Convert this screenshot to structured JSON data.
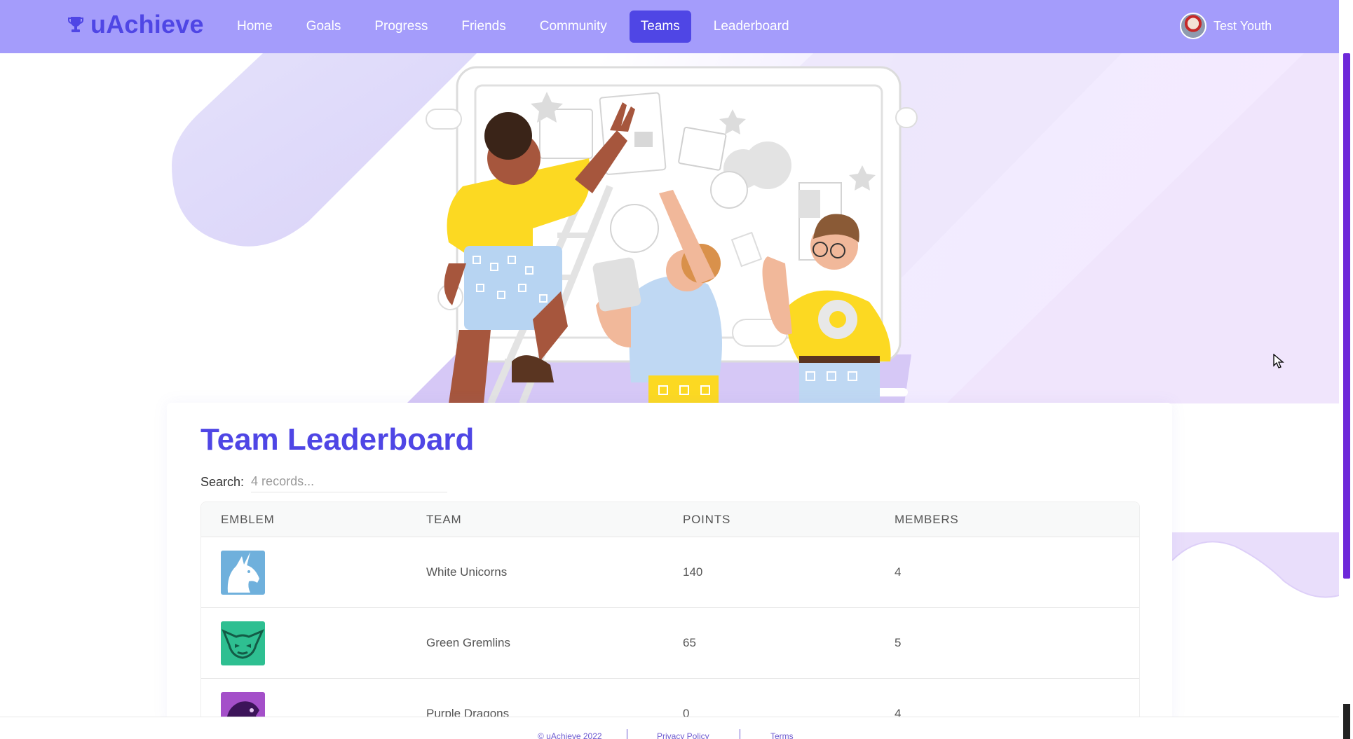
{
  "app": {
    "brand": "uAchieve",
    "user_name": "Test Youth"
  },
  "nav": {
    "items": [
      {
        "label": "Home",
        "active": false
      },
      {
        "label": "Goals",
        "active": false
      },
      {
        "label": "Progress",
        "active": false
      },
      {
        "label": "Friends",
        "active": false
      },
      {
        "label": "Community",
        "active": false
      },
      {
        "label": "Teams",
        "active": true
      },
      {
        "label": "Leaderboard",
        "active": false
      }
    ]
  },
  "leaderboard": {
    "title": "Team Leaderboard",
    "search_label": "Search:",
    "search_placeholder": "4 records...",
    "columns": [
      "EMBLEM",
      "TEAM",
      "POINTS",
      "MEMBERS"
    ],
    "rows": [
      {
        "emblem": "unicorn-emblem",
        "emblem_color": "#6fb0dc",
        "team": "White Unicorns",
        "points": "140",
        "members": "4"
      },
      {
        "emblem": "gremlin-emblem",
        "emblem_color": "#2ebf91",
        "team": "Green Gremlins",
        "points": "65",
        "members": "5"
      },
      {
        "emblem": "dragon-emblem",
        "emblem_color": "#a44fc9",
        "team": "Purple Dragons",
        "points": "0",
        "members": "4"
      }
    ]
  },
  "footer": {
    "copyright": "© uAchieve 2022",
    "privacy": "Privacy Policy",
    "terms": "Terms"
  },
  "colors": {
    "primary": "#4f46e5",
    "navbar": "#a49cfb"
  }
}
